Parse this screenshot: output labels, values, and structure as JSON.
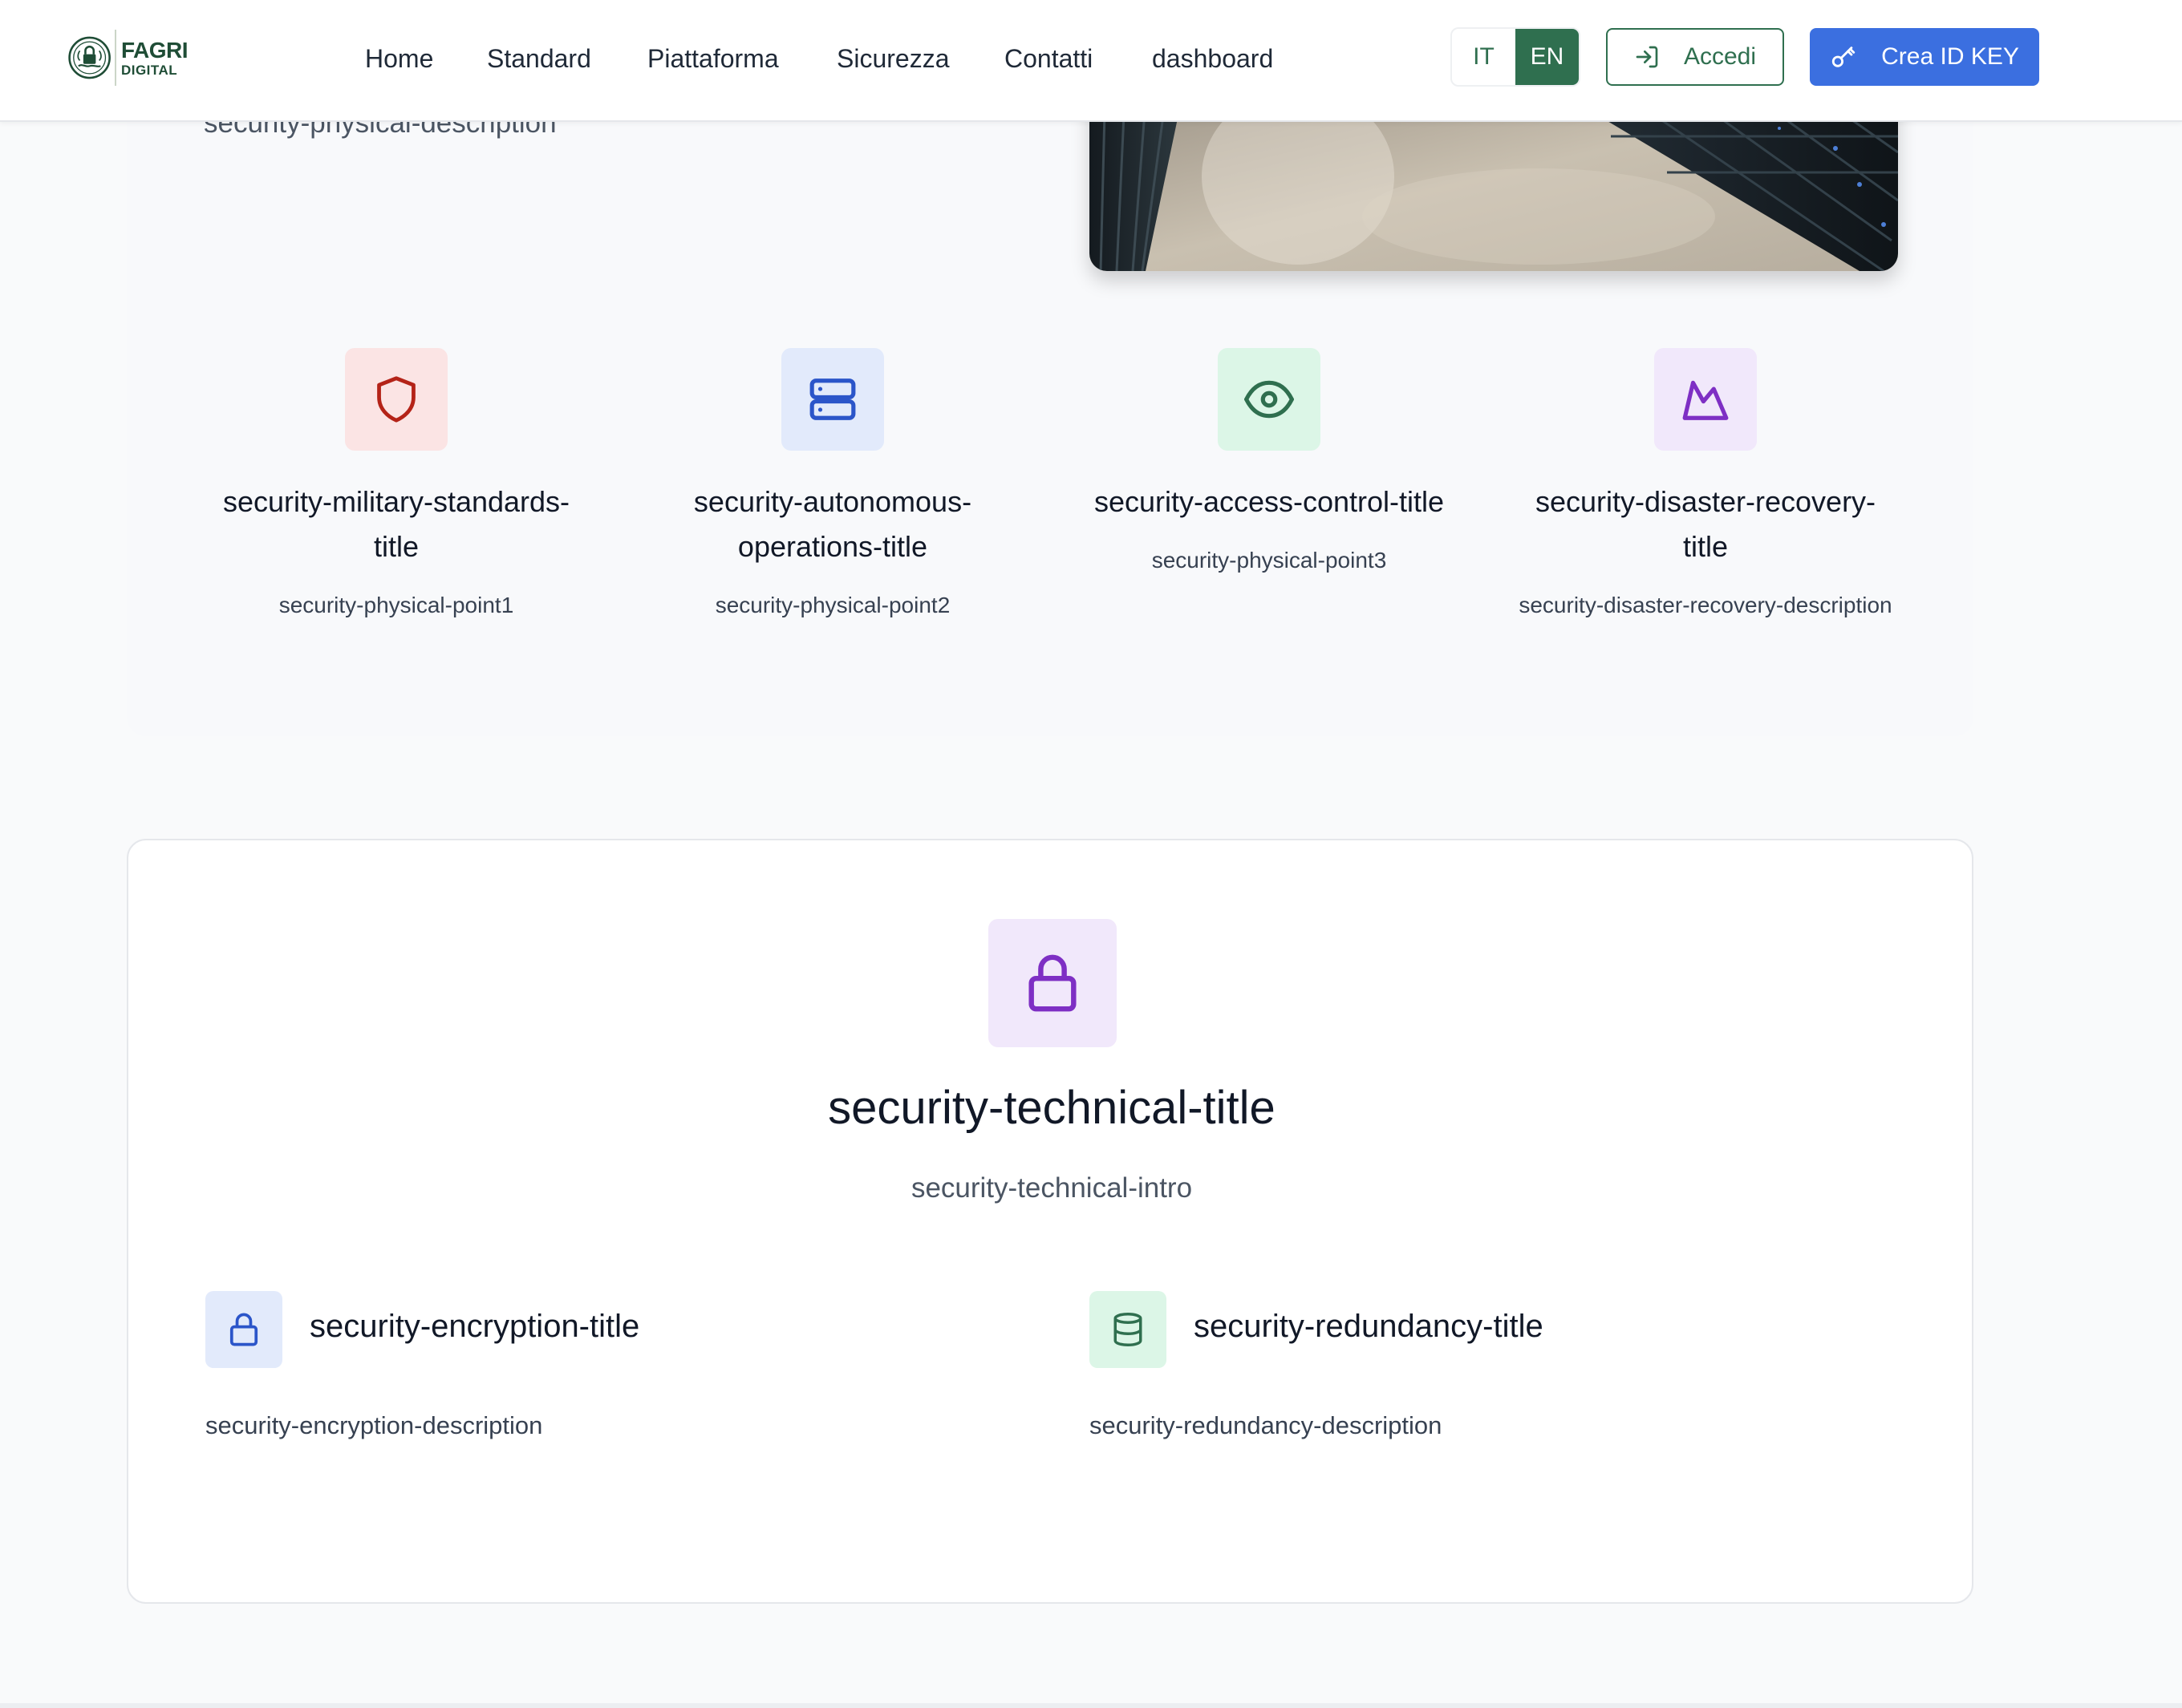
{
  "header": {
    "logo_line1": "FAGRI",
    "logo_line2": "DIGITAL",
    "nav": [
      "Home",
      "Standard",
      "Piattaforma",
      "Sicurezza",
      "Contatti",
      "dashboard"
    ],
    "lang_it": "IT",
    "lang_en": "EN",
    "active_lang": "EN",
    "login_label": "Accedi",
    "login_icon": "log-in-icon",
    "create_label": "Crea ID KEY",
    "create_icon": "key-icon"
  },
  "physical": {
    "description": "security-physical-description",
    "features": [
      {
        "title": "security-military-standards-title",
        "description": "security-physical-point1",
        "icon": "shield-icon",
        "icon_color": "#b42318",
        "icon_bg": "#fbe4e4"
      },
      {
        "title": "security-autonomous-operations-title",
        "description": "security-physical-point2",
        "icon": "server-icon",
        "icon_color": "#2b55c9",
        "icon_bg": "#e2eafb"
      },
      {
        "title": "security-access-control-title",
        "description": "security-physical-point3",
        "icon": "eye-icon",
        "icon_color": "#2f6f4f",
        "icon_bg": "#dcf6e7"
      },
      {
        "title": "security-disaster-recovery-title",
        "description": "security-disaster-recovery-description",
        "icon": "mountain-icon",
        "icon_color": "#7e2fc4",
        "icon_bg": "#f1e8fb"
      }
    ]
  },
  "technical": {
    "icon": "lock-icon",
    "title": "security-technical-title",
    "intro": "security-technical-intro",
    "items": [
      {
        "title": "security-encryption-title",
        "description": "security-encryption-description",
        "icon": "lock-icon",
        "icon_color": "#2b55c9",
        "icon_bg": "#e2eafb"
      },
      {
        "title": "security-redundancy-title",
        "description": "security-redundancy-description",
        "icon": "database-icon",
        "icon_color": "#2f6f4f",
        "icon_bg": "#dcf6e7"
      }
    ]
  },
  "colors": {
    "brand_green": "#2f6f4f",
    "primary_blue": "#3b6fe0",
    "purple": "#7e2fc4"
  }
}
